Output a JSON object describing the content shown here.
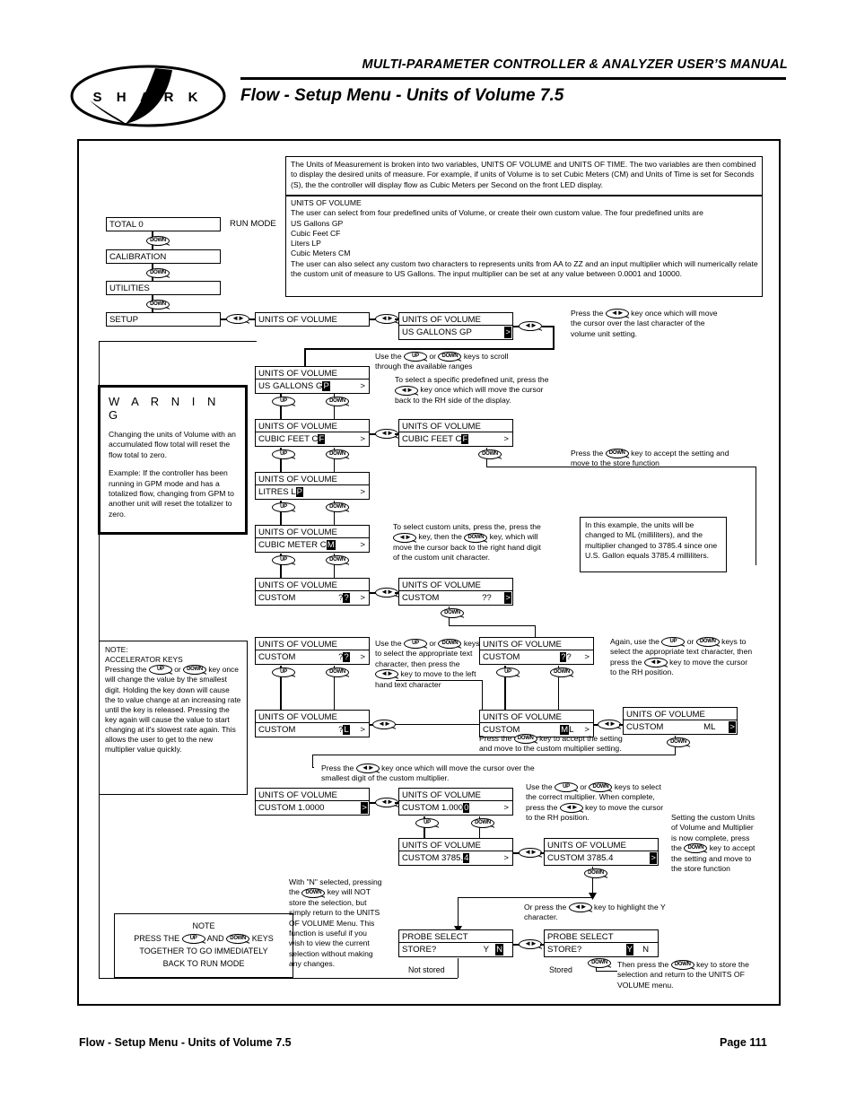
{
  "header": {
    "manual_title": "MULTI-PARAMETER CONTROLLER & ANALYZER USER’S MANUAL",
    "page_title": "Flow - Setup Menu - Units of Volume 7.5",
    "logo_text": "S H A R K"
  },
  "footer": {
    "left": "Flow - Setup Menu - Units of Volume 7.5",
    "right": "Page 111"
  },
  "intro": {
    "block1": "The Units of Measurement is broken into two variables, UNITS OF VOLUME and UNITS OF TIME. The two variables are then combined to display the desired units of measure. For example, if units of Volume is to set Cubic Meters (CM) and Units of Time is set for Seconds (S), the the controller will display flow as Cubic Meters per Second on the front LED display.",
    "block2_title": "UNITS OF VOLUME",
    "block2_line1": "The user can select from four predefined units of Volume, or create their own custom value. The four predefined units are",
    "units": [
      "US Gallons GP",
      "Cubic Feet CF",
      "Liters LP",
      "Cubic Meters CM"
    ],
    "block2_tail": "The user can also select any custom two characters to represents units from AA to ZZ and an input multiplier which will numerically relate the custom unit of measure to US Gallons. The input multiplier can be set at any value between 0.0001 and 10000."
  },
  "menu": {
    "total": "TOTAL     0",
    "run_mode": "RUN MODE",
    "calibration": "CALIBRATION",
    "utilities": "UTILITIES",
    "setup": "SETUP"
  },
  "keys": {
    "up": "UP",
    "down": "DOWN",
    "lr": "◄►"
  },
  "screens": {
    "uov_title": "UNITS OF VOLUME",
    "probe_title": "PROBE SELECT",
    "s_blank": "",
    "s_usgal_plain": "US  GALLONS  GP",
    "s_usgal_cursor_pre": "US  GALLONS      G",
    "s_usgal_cursor_char": "P",
    "s_cubft_pre": "CUBIC  FEET        C",
    "s_cubft_char": "F",
    "s_litres_pre": "LITRES               L",
    "s_litres_char": "P",
    "s_cubmtr_pre": "CUBIC  METER    C",
    "s_cubmtr_char": "M",
    "s_custom_label": "CUSTOM",
    "s_custom_qq_pre": "?",
    "s_custom_qq_char": "?",
    "s_custom_qq_plain": "??",
    "s_custom_ql_pre": "?",
    "s_custom_ql_char": "L",
    "s_custom_ml_char": "M",
    "s_custom_ml_post": "L",
    "s_custom_ml_plain": "ML",
    "s_mult_1_plain": "CUSTOM   1.0000",
    "s_mult_1_pre": "CUSTOM     1.000",
    "s_mult_1_char": "0",
    "s_mult_3785_pre": "CUSTOM    3785.",
    "s_mult_3785_char": "4",
    "s_mult_3785_plain": "CUSTOM    3785.4",
    "s_store_label": "STORE?",
    "store_y": "Y",
    "store_n": "N",
    "arrow": ">"
  },
  "annotations": {
    "a_press_lr_cursor_last": "Press the    key once which will move the cursor over the last character of the volume unit setting.",
    "a_scroll": "Use the      or        keys to scroll through the available ranges",
    "a_select_predefined": "To select a specific predefined unit, press the        key once which will move the cursor back to the RH side of the display.",
    "a_accept_store": "Press the          key to accept the setting and move to the store function",
    "a_custom_units": "To select custom units, press the, press the        key, then the         key, which will move the cursor back to the right hand digit of the custom unit character.",
    "a_example": "In this example, the units will be changed to ML (milliliters), and the multiplier changed to 3785.4 since one U.S. Gallon equals 3785.4 milliliters.",
    "a_text_char": "Use the       or        keys to select the appropriate text character, then press the         key to move to the left hand text character",
    "a_again_text_char": "Again, use the       or        keys to select the appropriate text character, then press the        key to move the cursor to the RH position.",
    "a_accept_custom_unit": "Press the         key to accept the setting and move to the custom multiplier setting.",
    "a_press_lr_smallest": "Press the        key once which will move the cursor over the smallest digit of the custom multiplier.",
    "a_correct_multiplier": "Use the       or         keys to select the correct multiplier. When complete, press the        key to move the cursor to the RH position.",
    "a_setting_complete": "Setting the custom Units of Volume and Multiplier is now complete, press the         key to accept the setting and move to the store function",
    "a_highlight_y": "Or press the        key to highlight the Y character.",
    "a_with_n": "With \"N\" selected, pressing the         key will NOT store the selection, but simply return to the UNITS OF VOLUME Menu. This function is useful if you wish to view the current selection without making any changes.",
    "a_then_press": "Then press the          key to store the selection and return to the UNITS OF VOLUME menu.",
    "a_not_stored": "Not stored",
    "a_stored": "Stored"
  },
  "warning": {
    "title": "W  A  R  N  I  N  G",
    "p1": "Changing the units of Volume with an accumulated flow total will reset the flow total to zero.",
    "p2": "Example: If the controller has been running in GPM mode and has a totalized flow, changing from GPM to another unit will reset the totalizer to zero."
  },
  "accelerator": {
    "line1": "NOTE:",
    "line2": "ACCELERATOR KEYS",
    "body_a": "Pressing the",
    "body_b": "or",
    "body_c": "key once will change the value by the smallest digit. Holding the key down will cause the to value change at an increasing rate until the key is released. Pressing the key again will cause the value to start changing at it's slowest rate again. This allows the user to get to the new multiplier value quickly."
  },
  "note": {
    "title": "NOTE",
    "l1a": "PRESS THE",
    "l1b": "AND",
    "l1c": "KEYS",
    "l2": "TOGETHER TO GO IMMEDIATELY",
    "l3": "BACK TO RUN MODE"
  }
}
